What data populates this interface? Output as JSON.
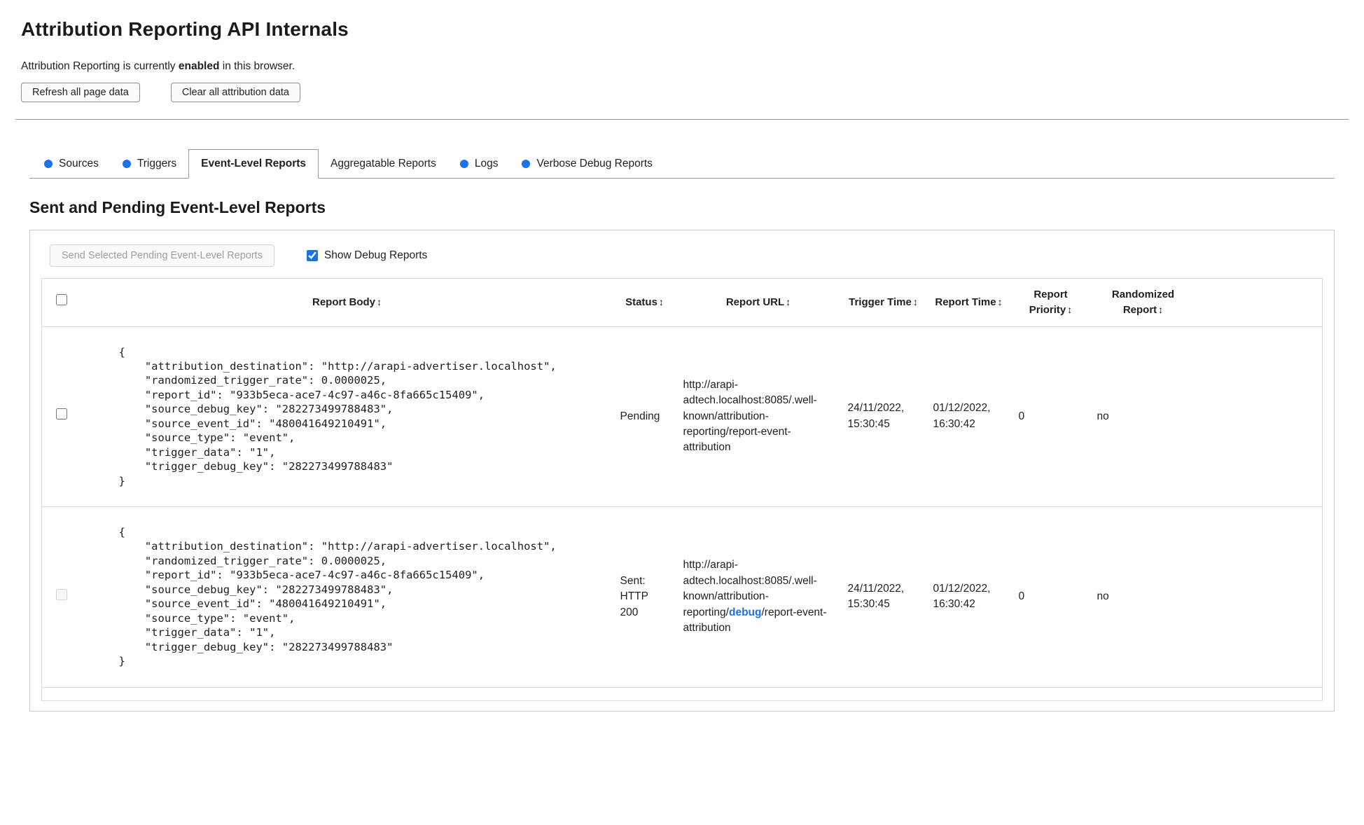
{
  "page": {
    "title": "Attribution Reporting API Internals",
    "status_prefix": "Attribution Reporting is currently ",
    "status_bold": "enabled",
    "status_suffix": " in this browser.",
    "refresh_button_label": "Refresh all page data",
    "clear_button_label": "Clear all attribution data"
  },
  "tabs": [
    {
      "label": "Sources",
      "has_new_data_dot": true,
      "active": false
    },
    {
      "label": "Triggers",
      "has_new_data_dot": true,
      "active": false
    },
    {
      "label": "Event-Level Reports",
      "has_new_data_dot": false,
      "active": true
    },
    {
      "label": "Aggregatable Reports",
      "has_new_data_dot": false,
      "active": false
    },
    {
      "label": "Logs",
      "has_new_data_dot": true,
      "active": false
    },
    {
      "label": "Verbose Debug Reports",
      "has_new_data_dot": true,
      "active": false
    }
  ],
  "section": {
    "heading": "Sent and Pending Event-Level Reports",
    "send_button_label": "Send Selected Pending Event-Level Reports",
    "send_button_disabled": true,
    "show_debug_label": "Show Debug Reports",
    "show_debug_checked": true
  },
  "table": {
    "sort_icon": "↕",
    "headers": [
      "Report Body",
      "Status",
      "Report URL",
      "Trigger Time",
      "Report Time",
      "Report Priority",
      "Randomized Report"
    ],
    "rows": [
      {
        "selected": false,
        "checkbox_disabled": false,
        "report_body": "{\n    \"attribution_destination\": \"http://arapi-advertiser.localhost\",\n    \"randomized_trigger_rate\": 0.0000025,\n    \"report_id\": \"933b5eca-ace7-4c97-a46c-8fa665c15409\",\n    \"source_debug_key\": \"282273499788483\",\n    \"source_event_id\": \"480041649210491\",\n    \"source_type\": \"event\",\n    \"trigger_data\": \"1\",\n    \"trigger_debug_key\": \"282273499788483\"\n}",
        "status": "Pending",
        "report_url_prefix": "http://arapi-adtech.localhost:8085/.well-known/attribution-reporting/report-event-attribution",
        "report_url_highlight": "",
        "report_url_suffix": "",
        "trigger_time": "24/11/2022, 15:30:45",
        "report_time": "01/12/2022, 16:30:42",
        "report_priority": "0",
        "randomized_report": "no"
      },
      {
        "selected": false,
        "checkbox_disabled": true,
        "report_body": "{\n    \"attribution_destination\": \"http://arapi-advertiser.localhost\",\n    \"randomized_trigger_rate\": 0.0000025,\n    \"report_id\": \"933b5eca-ace7-4c97-a46c-8fa665c15409\",\n    \"source_debug_key\": \"282273499788483\",\n    \"source_event_id\": \"480041649210491\",\n    \"source_type\": \"event\",\n    \"trigger_data\": \"1\",\n    \"trigger_debug_key\": \"282273499788483\"\n}",
        "status": "Sent: HTTP 200",
        "report_url_prefix": "http://arapi-adtech.localhost:8085/.well-known/attribution-reporting/",
        "report_url_highlight": "debug",
        "report_url_suffix": "/report-event-attribution",
        "trigger_time": "24/11/2022, 15:30:45",
        "report_time": "01/12/2022, 16:30:42",
        "report_priority": "0",
        "randomized_report": "no"
      }
    ]
  },
  "colors": {
    "accent_blue": "#1a73e8",
    "debug_highlight": "#1a73e8",
    "panel_border": "#c9c9c9",
    "table_border": "#d9d9d9"
  }
}
